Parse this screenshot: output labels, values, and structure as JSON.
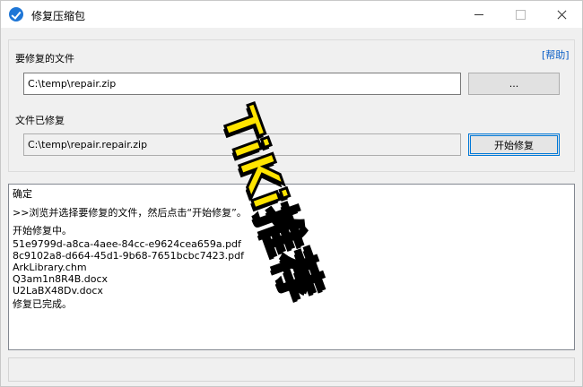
{
  "window": {
    "title": "修复压缩包"
  },
  "form": {
    "source_label": "要修复的文件",
    "help_label": "[帮助]",
    "source_value": "C:\\temp\\repair.zip",
    "browse_label": "...",
    "output_label": "文件已修复",
    "output_value": "C:\\temp\\repair.repair.zip",
    "start_label": "开始修复"
  },
  "log": {
    "lines": [
      "确定",
      ">>浏览并选择要修复的文件，然后点击“开始修复”。",
      "开始修复中。",
      "51e9799d-a8ca-4aee-84cc-e9624cea659a.pdf",
      "8c9102a8-d664-45d1-9b68-7651bcbc7423.pdf",
      "ArkLibrary.chm",
      "Q3am1n8R4B.docx",
      "U2LaBX48Dv.docx",
      "修复已完成。"
    ]
  },
  "watermark": {
    "text": "TiKi推荐",
    "color": "#ffe400"
  },
  "colors": {
    "accent": "#0078d7",
    "link": "#0b5ec6",
    "app_icon": "#1e76d6"
  }
}
